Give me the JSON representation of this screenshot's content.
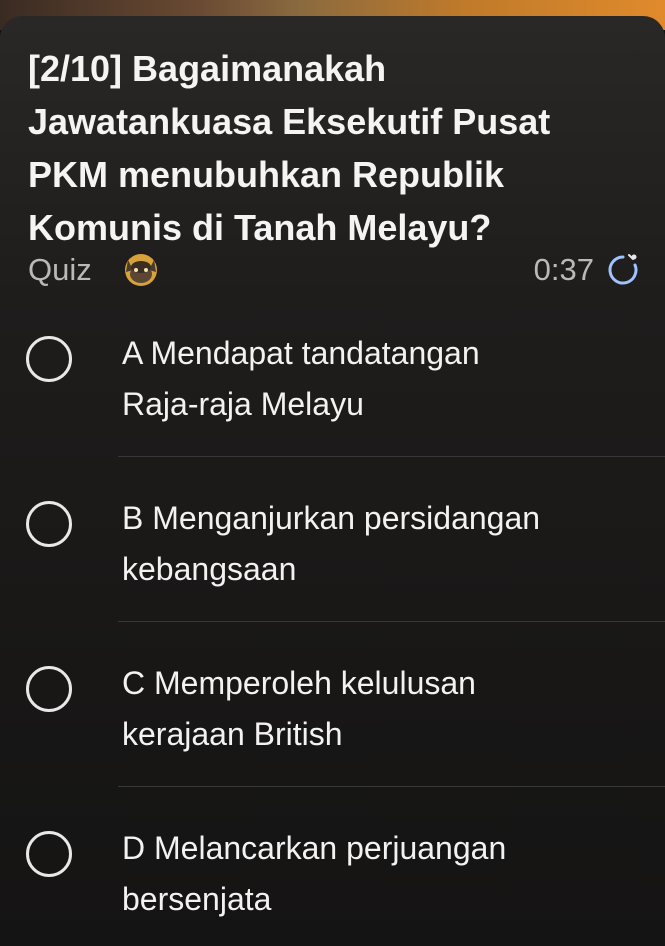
{
  "question": {
    "line1": "[2/10] Bagaimanakah",
    "line2": "Jawatankuasa Eksekutif Pusat",
    "line3": "PKM menubuhkan Republik",
    "line4": "Komunis di Tanah Melayu?"
  },
  "meta": {
    "quiz_label": "Quiz",
    "quiz_icon": "cat-avatar-icon",
    "timer": "0:37",
    "timer_icon": "stopwatch-icon"
  },
  "options": [
    {
      "line1": "A Mendapat tandatangan",
      "line2": "Raja-raja Melayu"
    },
    {
      "line1": "B Menganjurkan persidangan",
      "line2": "kebangsaan"
    },
    {
      "line1": "C Memperoleh kelulusan",
      "line2": "kerajaan British"
    },
    {
      "line1": "D Melancarkan perjuangan",
      "line2": "bersenjata"
    }
  ],
  "colors": {
    "background": "#111111",
    "card": "#1f1d1c",
    "text": "#f2f2f2",
    "muted": "#b9b9b9"
  }
}
